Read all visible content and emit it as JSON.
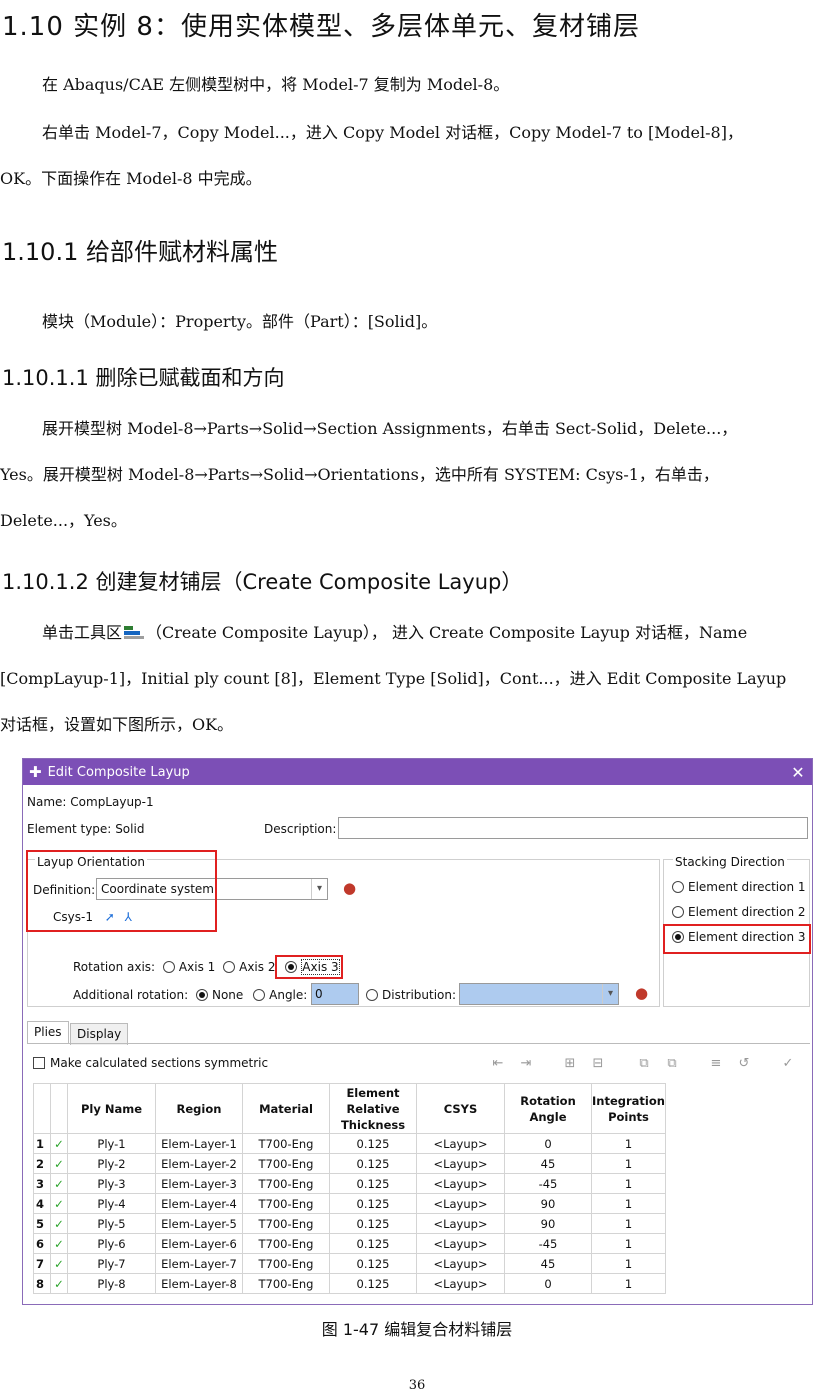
{
  "heading": "1.10 实例 8：使用实体模型、多层体单元、复材铺层",
  "paragraphs": {
    "p1": "在 Abaqus/CAE 左侧模型树中，将 Model-7 复制为 Model-8。",
    "p2_l1": "右单击 Model-7，Copy Model...，进入 Copy Model 对话框，Copy Model-7 to [Model-8]，",
    "p2_l2": "OK。下面操作在 Model-8 中完成。",
    "p3": "模块（Module）：Property。部件（Part）：[Solid]。",
    "p4_l1": "展开模型树 Model-8→Parts→Solid→Section Assignments，右单击 Sect-Solid，Delete...，",
    "p4_l2": "Yes。展开模型树 Model-8→Parts→Solid→Orientations，选中所有 SYSTEM: Csys-1，右单击，",
    "p4_l3": "Delete...，Yes。",
    "p5_l1_a": "单击工具区",
    "p5_l1_b": "（Create Composite Layup）， 进入 Create Composite Layup 对话框，Name",
    "p5_l2": "[CompLayup-1]，Initial ply count [8]，Element Type [Solid]，Cont...，进入 Edit Composite Layup",
    "p5_l3": "对话框，设置如下图所示，OK。"
  },
  "sections": {
    "s1": "1.10.1 给部件赋材料属性",
    "s2": "1.10.1.1 删除已赋截面和方向",
    "s3": "1.10.1.2 创建复材铺层（Create Composite Layup）"
  },
  "dialog": {
    "title": "Edit Composite Layup",
    "name_label": "Name:",
    "name_value": "CompLayup-1",
    "element_type_label": "Element type:",
    "element_type_value": "Solid",
    "description_label": "Description:",
    "description_value": "",
    "layup_orientation": {
      "title": "Layup Orientation",
      "definition_label": "Definition:",
      "definition_value": "Coordinate system",
      "csys_value": "Csys-1"
    },
    "stacking": {
      "title": "Stacking Direction",
      "options": [
        "Element direction 1",
        "Element direction 2",
        "Element direction 3"
      ],
      "selected": "Element direction 3"
    },
    "rotation_axis": {
      "label": "Rotation axis:",
      "options": [
        "Axis 1",
        "Axis 2",
        "Axis 3"
      ],
      "selected": "Axis 3"
    },
    "additional_rotation": {
      "label": "Additional rotation:",
      "none": "None",
      "angle": "Angle:",
      "angle_value": "0",
      "distribution": "Distribution:",
      "selected": "None"
    },
    "tabs": [
      "Plies",
      "Display"
    ],
    "symmetric_label": "Make calculated sections symmetric",
    "columns": [
      "Ply Name",
      "Region",
      "Material",
      "Element Relative Thickness",
      "CSYS",
      "Rotation Angle",
      "Integration Points"
    ],
    "rows": [
      {
        "n": "1",
        "name": "Ply-1",
        "region": "Elem-Layer-1",
        "material": "T700-Eng",
        "thickness": "0.125",
        "csys": "<Layup>",
        "angle": "0",
        "points": "1"
      },
      {
        "n": "2",
        "name": "Ply-2",
        "region": "Elem-Layer-2",
        "material": "T700-Eng",
        "thickness": "0.125",
        "csys": "<Layup>",
        "angle": "45",
        "points": "1"
      },
      {
        "n": "3",
        "name": "Ply-3",
        "region": "Elem-Layer-3",
        "material": "T700-Eng",
        "thickness": "0.125",
        "csys": "<Layup>",
        "angle": "-45",
        "points": "1"
      },
      {
        "n": "4",
        "name": "Ply-4",
        "region": "Elem-Layer-4",
        "material": "T700-Eng",
        "thickness": "0.125",
        "csys": "<Layup>",
        "angle": "90",
        "points": "1"
      },
      {
        "n": "5",
        "name": "Ply-5",
        "region": "Elem-Layer-5",
        "material": "T700-Eng",
        "thickness": "0.125",
        "csys": "<Layup>",
        "angle": "90",
        "points": "1"
      },
      {
        "n": "6",
        "name": "Ply-6",
        "region": "Elem-Layer-6",
        "material": "T700-Eng",
        "thickness": "0.125",
        "csys": "<Layup>",
        "angle": "-45",
        "points": "1"
      },
      {
        "n": "7",
        "name": "Ply-7",
        "region": "Elem-Layer-7",
        "material": "T700-Eng",
        "thickness": "0.125",
        "csys": "<Layup>",
        "angle": "45",
        "points": "1"
      },
      {
        "n": "8",
        "name": "Ply-8",
        "region": "Elem-Layer-8",
        "material": "T700-Eng",
        "thickness": "0.125",
        "csys": "<Layup>",
        "angle": "0",
        "points": "1"
      }
    ]
  },
  "caption": "图 1-47   编辑复合材料铺层",
  "page_number": "36",
  "colors": {
    "titlebar": "#7c4fb6",
    "highlight": "#e02020",
    "check": "#2aa32a"
  }
}
